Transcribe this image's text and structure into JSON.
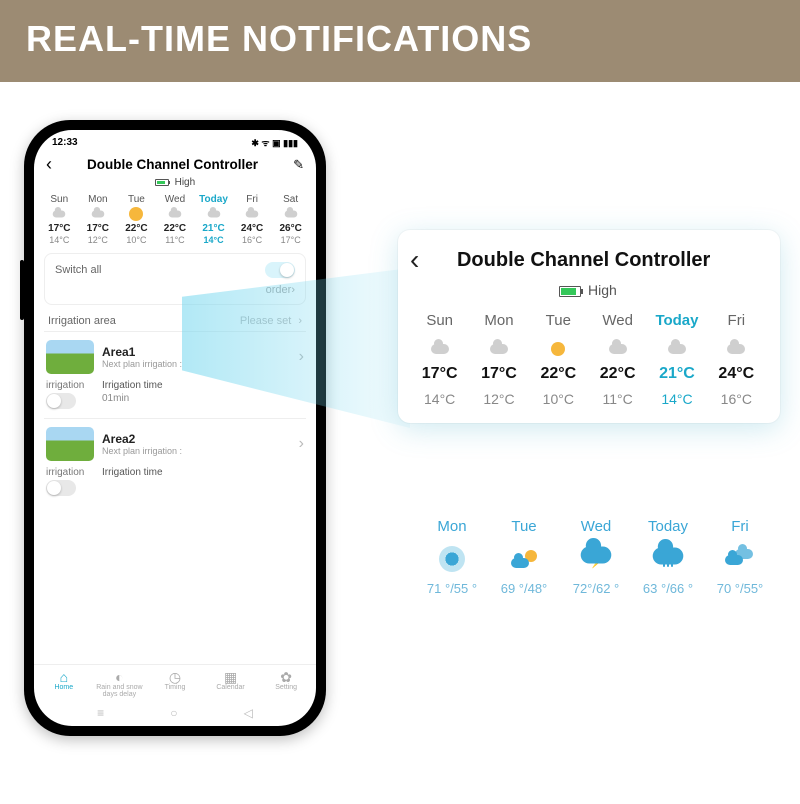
{
  "banner": {
    "title": "REAL-TIME NOTIFICATIONS"
  },
  "statusbar": {
    "time": "12:33",
    "icons": "✱ ᯤ ▣ ▮▮▮"
  },
  "app": {
    "title": "Double Channel Controller",
    "battery_label": "High"
  },
  "forecast_phone": [
    {
      "day": "Sun",
      "hi": "17°C",
      "lo": "14°C",
      "icon": "cloud"
    },
    {
      "day": "Mon",
      "hi": "17°C",
      "lo": "12°C",
      "icon": "cloud"
    },
    {
      "day": "Tue",
      "hi": "22°C",
      "lo": "10°C",
      "icon": "sun"
    },
    {
      "day": "Wed",
      "hi": "22°C",
      "lo": "11°C",
      "icon": "cloud"
    },
    {
      "day": "Today",
      "hi": "21°C",
      "lo": "14°C",
      "icon": "cloud",
      "today": true
    },
    {
      "day": "Fri",
      "hi": "24°C",
      "lo": "16°C",
      "icon": "cloud"
    },
    {
      "day": "Sat",
      "hi": "26°C",
      "lo": "17°C",
      "icon": "cloud"
    }
  ],
  "switch_all": {
    "label": "Switch all",
    "order": "order"
  },
  "irrigation_area": {
    "label": "Irrigation area",
    "value": "Please set"
  },
  "areas": [
    {
      "name": "Area1",
      "sub": "Next plan irrigation :",
      "col1": "irrigation",
      "col2": "Irrigation time",
      "val": "01min"
    },
    {
      "name": "Area2",
      "sub": "Next plan irrigation :",
      "col1": "irrigation",
      "col2": "Irrigation time",
      "val": ""
    }
  ],
  "tabs": [
    {
      "label": "Home",
      "active": true
    },
    {
      "label": "Rain and snow days delay"
    },
    {
      "label": "Timing"
    },
    {
      "label": "Calendar"
    },
    {
      "label": "Setting"
    }
  ],
  "zoom": {
    "title": "Double Channel Controller",
    "battery_label": "High",
    "days": [
      {
        "day": "Sun",
        "hi": "17°C",
        "lo": "14°C",
        "icon": "cloud"
      },
      {
        "day": "Mon",
        "hi": "17°C",
        "lo": "12°C",
        "icon": "cloud"
      },
      {
        "day": "Tue",
        "hi": "22°C",
        "lo": "10°C",
        "icon": "sun"
      },
      {
        "day": "Wed",
        "hi": "22°C",
        "lo": "11°C",
        "icon": "cloud"
      },
      {
        "day": "Today",
        "hi": "21°C",
        "lo": "14°C",
        "icon": "cloud",
        "today": true
      },
      {
        "day": "Fri",
        "hi": "24°C",
        "lo": "16°C",
        "icon": "cloud"
      }
    ]
  },
  "blue_forecast": [
    {
      "day": "Mon",
      "range": "71 °/55 °",
      "icon": "ring"
    },
    {
      "day": "Tue",
      "range": "69 °/48°",
      "icon": "suncloud"
    },
    {
      "day": "Wed",
      "range": "72°/62 °",
      "icon": "storm"
    },
    {
      "day": "Today",
      "range": "63 °/66 °",
      "icon": "rain"
    },
    {
      "day": "Fri",
      "range": "70 °/55°",
      "icon": "clouds"
    }
  ]
}
